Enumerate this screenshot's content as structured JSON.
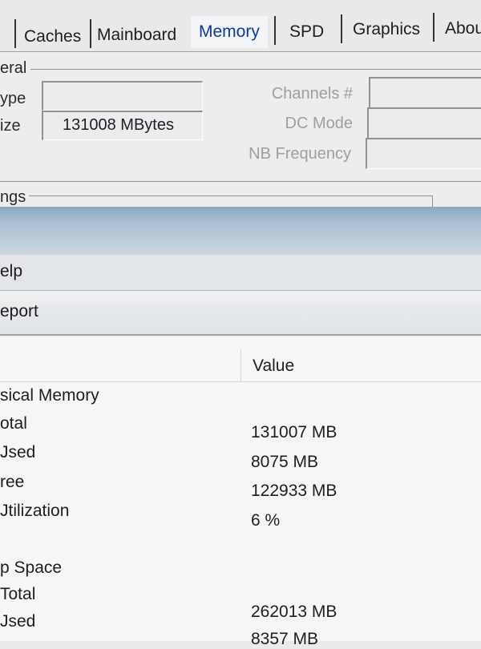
{
  "tabs": [
    "Caches",
    "Mainboard",
    "Memory",
    "SPD",
    "Graphics",
    "Abou"
  ],
  "general": {
    "group_label": "eral",
    "type_label": "ype",
    "size_label": "ize",
    "size_value": "131008 MBytes",
    "channels_label": "Channels #",
    "dc_mode_label": "DC Mode",
    "nb_frequency_label": "NB Frequency"
  },
  "timings": {
    "group_label": "ngs"
  },
  "menubar": {
    "help": "elp"
  },
  "toolbar": {
    "report": "eport"
  },
  "table": {
    "value_header": "Value",
    "rows": [
      {
        "label": "sical Memory",
        "value": ""
      },
      {
        "label": "otal",
        "value": "131007 MB"
      },
      {
        "label": "Jsed",
        "value": "8075 MB"
      },
      {
        "label": "ree",
        "value": "122933 MB"
      },
      {
        "label": "Jtilization",
        "value": "6 %"
      },
      {
        "label": "",
        "value": ""
      },
      {
        "label": "p Space",
        "value": ""
      },
      {
        "label": "Total",
        "value": ""
      },
      {
        "label": "Jsed",
        "value": "262013 MB"
      },
      {
        "label": "",
        "value": "8357 MB"
      }
    ]
  },
  "colors": {
    "active_tab": "#0b3aa8",
    "titlebar": "#a8bfd2"
  }
}
